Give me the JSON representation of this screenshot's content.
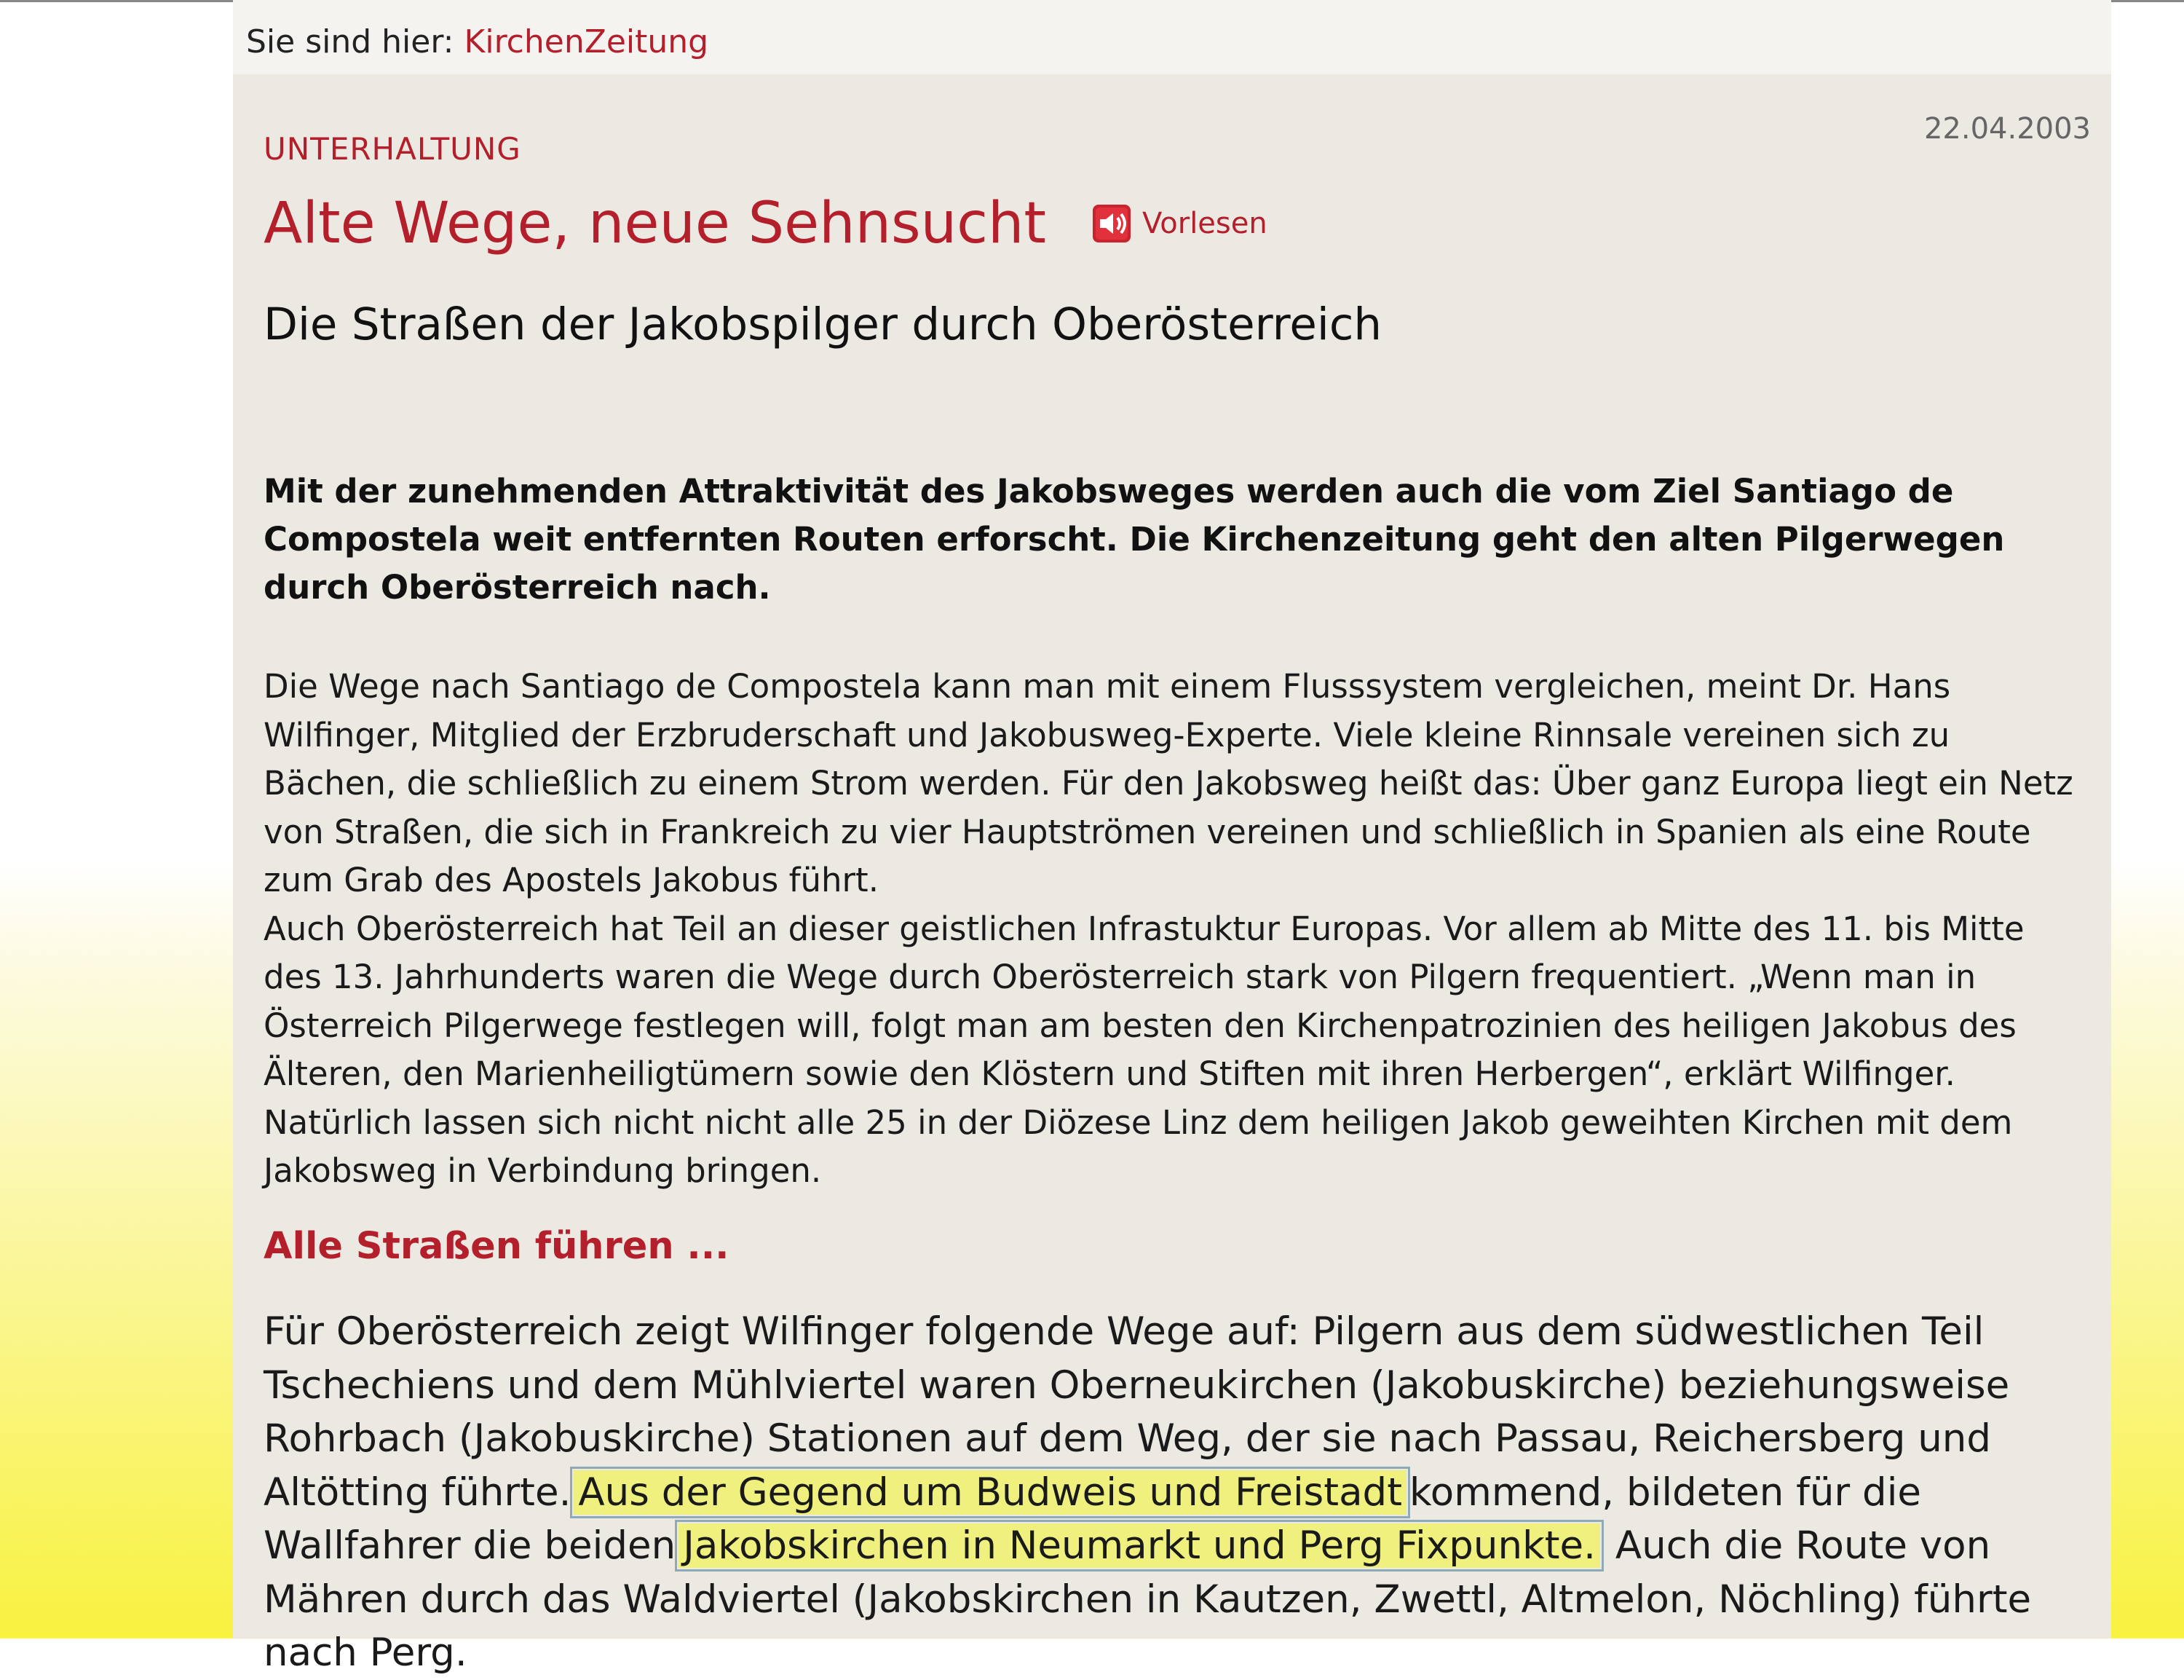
{
  "breadcrumb": {
    "prefix": "Sie sind hier:",
    "link": "KirchenZeitung"
  },
  "article": {
    "date": "22.04.2003",
    "category": "UNTERHALTUNG",
    "title": "Alte Wege, neue Sehnsucht",
    "vorlesen_label": "Vorlesen",
    "subtitle": "Die Straßen der Jakobspilger durch Oberösterreich",
    "lead": "Mit der zunehmenden Attraktivität des Jakobsweges werden auch die vom Ziel Santiago de Compostela weit entfernten Routen erforscht. Die Kirchenzeitung geht den alten Pilgerwegen durch Oberösterreich nach.",
    "paragraph1": "Die Wege nach Santiago de Compostela kann man mit einem Flusssystem vergleichen, meint Dr. Hans Wilfinger, Mitglied der Erzbruderschaft und Jakobusweg-Experte. Viele kleine Rinnsale vereinen sich zu Bächen, die schließlich zu einem Strom werden. Für den Jakobsweg heißt das: Über ganz Europa liegt ein Netz von Straßen, die sich in Frankreich zu vier Hauptströmen vereinen und schließlich in Spanien als eine Route zum Grab des Apostels Jakobus führt.",
    "paragraph2": "Auch Oberösterreich hat Teil an dieser geistlichen Infrastuktur Europas. Vor allem ab Mitte des 11. bis Mitte des 13. Jahrhunderts waren die Wege durch Oberösterreich stark von Pilgern frequentiert. „Wenn man in Österreich Pilgerwege festlegen will, folgt man am besten den Kirchenpatrozinien des heiligen Jakobus des Älteren, den Marienheiligtümern sowie den Klöstern und Stiften mit ihren Herbergen“, erklärt Wilfinger. Natürlich lassen sich nicht nicht alle 25 in der Diözese Linz dem heiligen Jakob geweihten Kirchen mit dem Jakobsweg in Verbindung bringen.",
    "section_heading": "Alle Straßen führen ...",
    "section_text_1": "Für Oberösterreich zeigt Wilfinger folgende Wege auf: Pilgern aus dem südwestlichen Teil Tschechiens und dem Mühlviertel waren Oberneukirchen (Jakobuskirche) beziehungsweise Rohrbach (Jakobuskirche) Stationen auf dem Weg, der sie nach Passau, Reichersberg und Altötting führte.",
    "highlight_1": "Aus der Gegend um Budweis und Freistadt",
    "section_text_2": "kommend, bildeten für die Wallfahrer die beiden",
    "highlight_2": "Jakobskirchen in Neumarkt und Perg Fixpunkte.",
    "section_text_3": "Auch die Route von Mähren durch das Waldviertel (Jakobskirchen in Kautzen, Zwettl, Altmelon, Nöchling) führte nach Perg."
  },
  "colors": {
    "accent_red": "#b41f2c",
    "page_background": "#ece9e2",
    "highlight": "#eff07d"
  },
  "icons": {
    "vorlesen": "speaker-icon"
  }
}
